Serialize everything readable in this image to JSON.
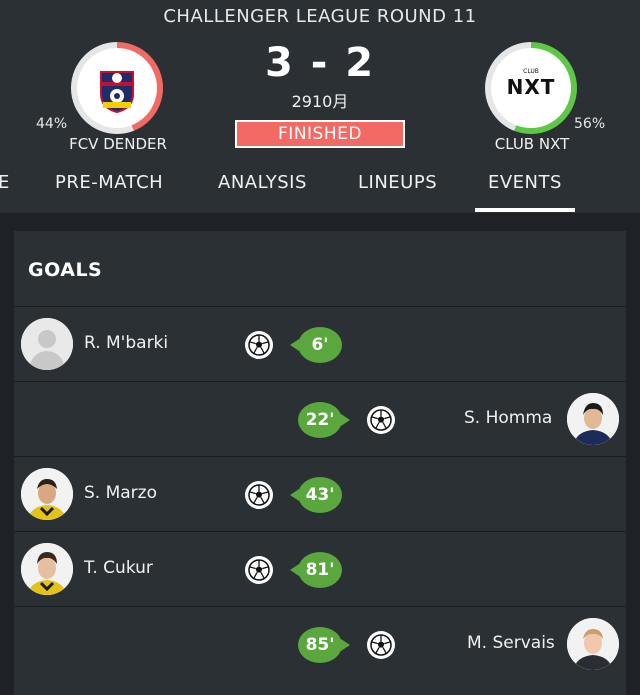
{
  "match": {
    "league": "CHALLENGER LEAGUE ROUND 11",
    "score": "3 - 2",
    "date": "2910月",
    "status": "FINISHED"
  },
  "home": {
    "name": "FCV DENDER",
    "possession": "44%",
    "possession_fraction": 0.44,
    "ring_color": "#f26a63",
    "logo_icon": "fcv-dender-crest-icon"
  },
  "away": {
    "name": "CLUB NXT",
    "possession": "56%",
    "possession_fraction": 0.56,
    "ring_color": "#5ec748",
    "logo_icon": "club-nxt-logo-icon",
    "logo_text": "NXT",
    "logo_small_text": "CLUB"
  },
  "tabs": [
    {
      "label": "E"
    },
    {
      "label": "PRE-MATCH"
    },
    {
      "label": "ANALYSIS"
    },
    {
      "label": "LINEUPS"
    },
    {
      "label": "EVENTS",
      "active": true
    }
  ],
  "goals": {
    "title": "GOALS",
    "events": [
      {
        "player": "R. M'barki",
        "minute": "6'",
        "side": "home"
      },
      {
        "player": "S. Homma",
        "minute": "22'",
        "side": "away"
      },
      {
        "player": "S. Marzo",
        "minute": "43'",
        "side": "home"
      },
      {
        "player": "T. Cukur",
        "minute": "81'",
        "side": "home"
      },
      {
        "player": "M. Servais",
        "minute": "85'",
        "side": "away"
      }
    ]
  }
}
